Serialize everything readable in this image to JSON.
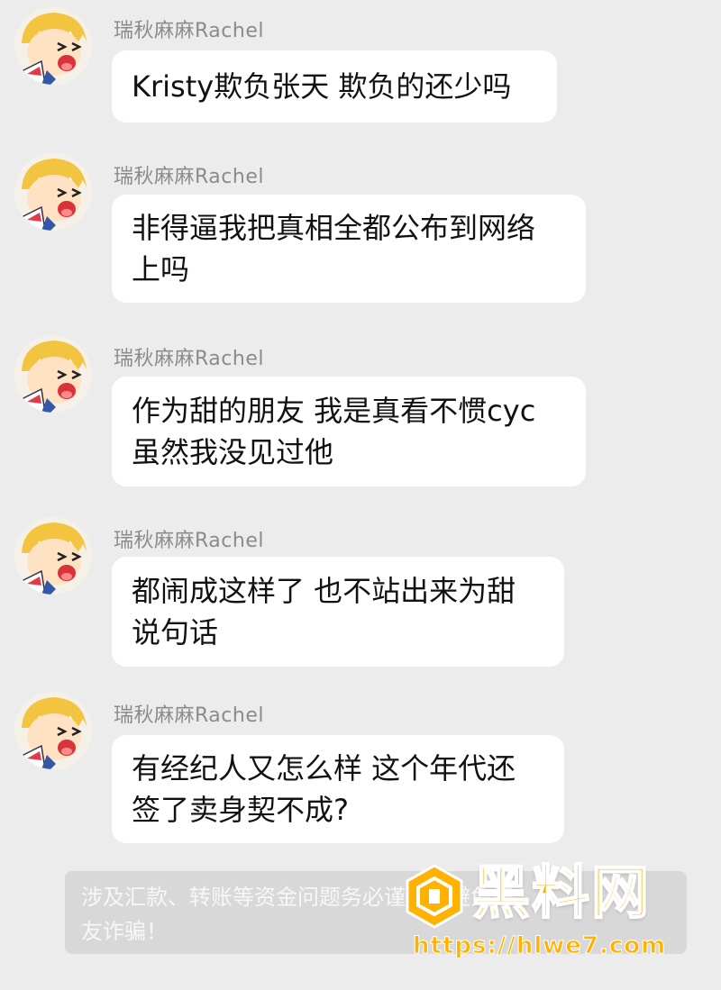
{
  "theme": {
    "background": "#ececec",
    "bubble_background": "#ffffff",
    "sender_color": "#8b8b8b",
    "notice_background": "#d8d8d8",
    "watermark_color": "#ffb300"
  },
  "messages": [
    {
      "sender": "瑞秋麻麻Rachel",
      "avatar_icon": "cartoon-girl-avatar-icon",
      "text": "Kristy欺负张天 欺负的还少吗"
    },
    {
      "sender": "瑞秋麻麻Rachel",
      "avatar_icon": "cartoon-girl-avatar-icon",
      "text": "非得逼我把真相全都公布到网络\n上吗"
    },
    {
      "sender": "瑞秋麻麻Rachel",
      "avatar_icon": "cartoon-girl-avatar-icon",
      "text": "作为甜的朋友 我是真看不惯cyc\n虽然我没见过他"
    },
    {
      "sender": "瑞秋麻麻Rachel",
      "avatar_icon": "cartoon-girl-avatar-icon",
      "text": "都闹成这样了 也不站出来为甜\n说句话"
    },
    {
      "sender": "瑞秋麻麻Rachel",
      "avatar_icon": "cartoon-girl-avatar-icon",
      "text": "有经纪人又怎么样 这个年代还\n签了卖身契不成?"
    }
  ],
  "system_notice": {
    "text": "涉及汇款、转账等资金问题务必谨慎，避免好\n友诈骗！"
  },
  "watermark": {
    "logo_icon": "hexagon-logo-icon",
    "title": "黑料网",
    "url": "https://hlwe7.com"
  }
}
